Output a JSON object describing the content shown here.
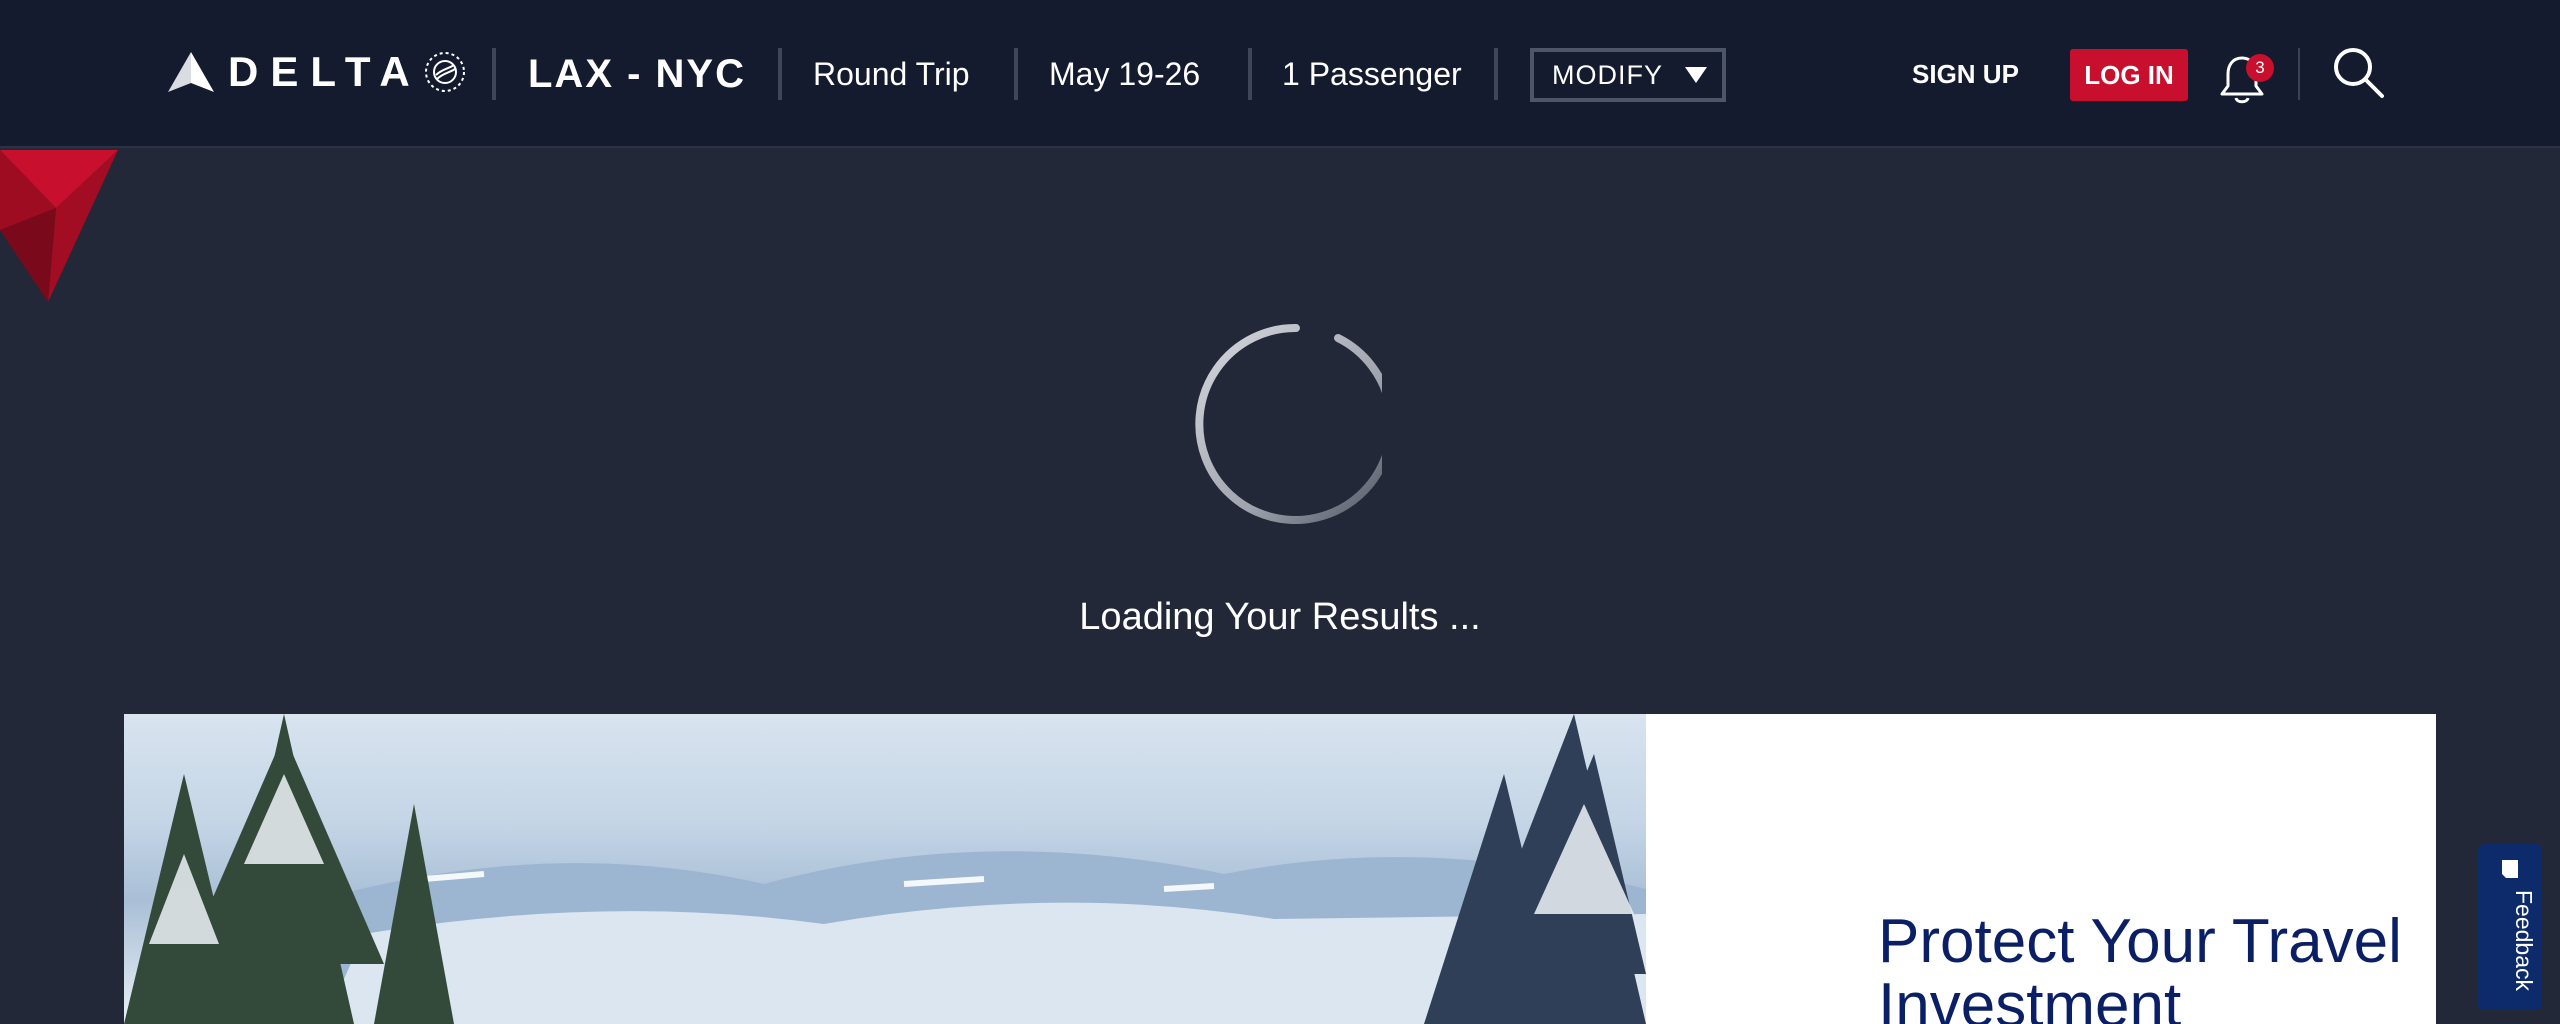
{
  "header": {
    "brand": "DELTA",
    "route": "LAX - NYC",
    "trip_type": "Round Trip",
    "dates": "May 19-26",
    "passengers": "1 Passenger",
    "modify_label": "MODIFY",
    "signup_label": "SIGN UP",
    "login_label": "LOG IN",
    "notification_count": "3"
  },
  "main": {
    "loading_text": "Loading Your Results ..."
  },
  "promo": {
    "title": "Protect Your Travel Investment"
  },
  "feedback": {
    "label": "Feedback"
  },
  "colors": {
    "header_bg": "#151b2e",
    "page_bg": "#222838",
    "brand_red": "#c8102e",
    "promo_title": "#0b1f66",
    "feedback_bg": "#0d2b6b"
  },
  "icons": [
    "delta-widget-logo-icon",
    "skyteam-icon",
    "caret-down-icon",
    "bell-icon",
    "search-icon",
    "loading-spinner-icon",
    "feedback-icon"
  ]
}
